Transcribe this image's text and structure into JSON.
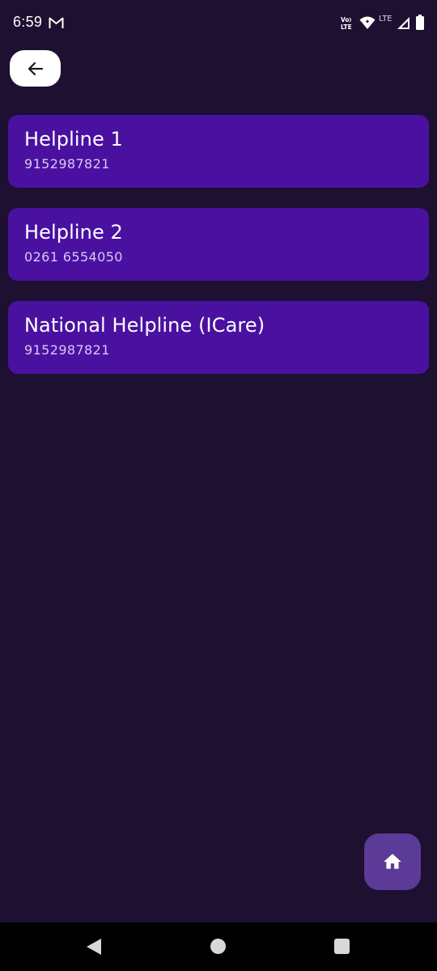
{
  "status_bar": {
    "time": "6:59",
    "notification_icon": "gmail-icon",
    "volte_label": "Vo LTE",
    "network_label": "LTE",
    "icons": [
      "volte-icon",
      "wifi-icon",
      "signal-icon",
      "battery-icon"
    ]
  },
  "header": {
    "back_icon": "arrow-left-icon"
  },
  "helplines": [
    {
      "name": "Helpline 1",
      "number": "9152987821"
    },
    {
      "name": "Helpline 2",
      "number": "0261 6554050"
    },
    {
      "name": "National Helpline (ICare)",
      "number": "9152987821"
    }
  ],
  "fab": {
    "icon": "home-icon"
  },
  "navigation": {
    "icons": [
      "nav-back-icon",
      "nav-home-icon",
      "nav-recents-icon"
    ]
  },
  "colors": {
    "background": "#1d1030",
    "card": "#4a11a1",
    "card_subtext": "#d9c8f2",
    "fab": "#5c3a97",
    "back_button": "#ffffff",
    "nav_bar": "#000000"
  }
}
